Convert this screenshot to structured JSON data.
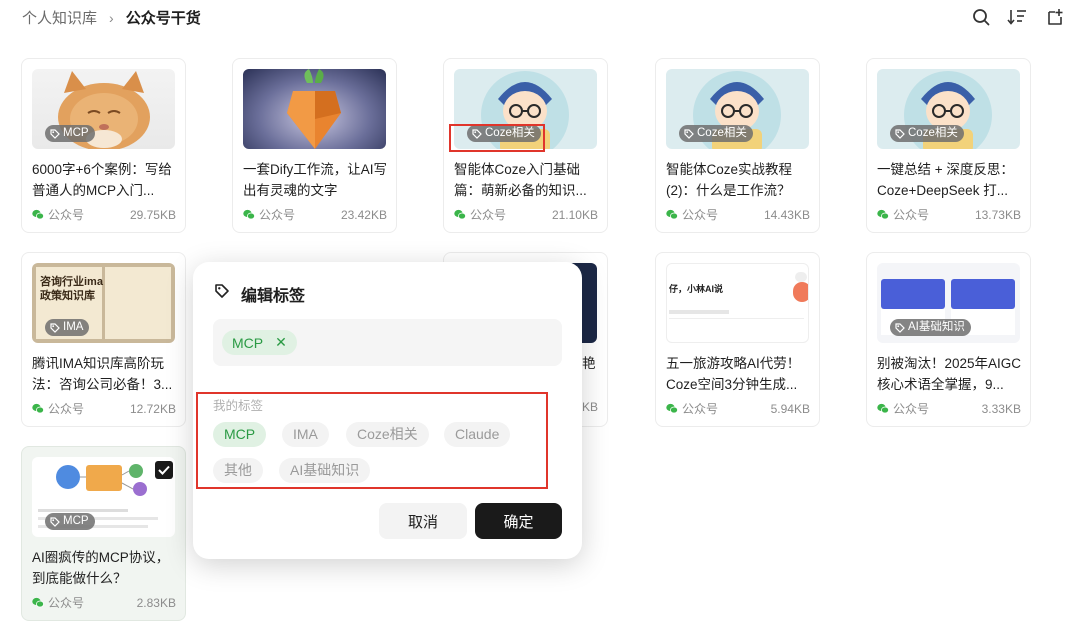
{
  "breadcrumb": {
    "root": "个人知识库",
    "separator": "›",
    "current": "公众号干货"
  },
  "toolbar": {
    "icons": [
      "search-icon",
      "sort-icon",
      "add-page-icon"
    ]
  },
  "source_label": "公众号",
  "cards": [
    {
      "title": "6000字+6个案例：写给普通人的MCP入门...",
      "tag": "MCP",
      "size": "29.75KB"
    },
    {
      "title": "一套Dify工作流，让AI写出有灵魂的文字",
      "tag": "",
      "size": "23.42KB"
    },
    {
      "title": "智能体Coze入门基础篇：萌新必备的知识...",
      "tag": "Coze相关",
      "size": "21.10KB"
    },
    {
      "title": "智能体Coze实战教程(2)：什么是工作流？",
      "tag": "Coze相关",
      "size": "14.43KB"
    },
    {
      "title": "一键总结 + 深度反思：Coze+DeepSeek 打...",
      "tag": "Coze相关",
      "size": "13.73KB"
    },
    {
      "title": "腾讯IMA知识库高阶玩法：咨询公司必备！3...",
      "tag": "IMA",
      "size": "12.72KB"
    },
    {
      "title": "艳",
      "tag": "",
      "size": "KB"
    },
    {
      "title": "五一旅游攻略AI代劳！Coze空间3分钟生成...",
      "tag": "",
      "size": "5.94KB"
    },
    {
      "title": "别被淘汰！2025年AIGC核心术语全掌握，9...",
      "tag": "AI基础知识",
      "size": "3.33KB"
    },
    {
      "title": "AI圈疯传的MCP协议，到底能做什么？",
      "tag": "MCP",
      "size": "2.83KB"
    }
  ],
  "thumb_text": {
    "ima_line1": "咨询行业ima",
    "ima_line2": "政策知识库",
    "coze_space": "仔，小林AI说"
  },
  "modal": {
    "title": "编辑标签",
    "selected_tags": [
      "MCP"
    ],
    "my_tags_label": "我的标签",
    "my_tags": [
      "MCP",
      "IMA",
      "Coze相关",
      "Claude",
      "其他",
      "AI基础知识"
    ],
    "active_tag": "MCP",
    "cancel": "取消",
    "confirm": "确定"
  },
  "colors": {
    "accent_green": "#2a9a44",
    "highlight_red": "#e0352b",
    "confirm_bg": "#1a1a1a"
  }
}
